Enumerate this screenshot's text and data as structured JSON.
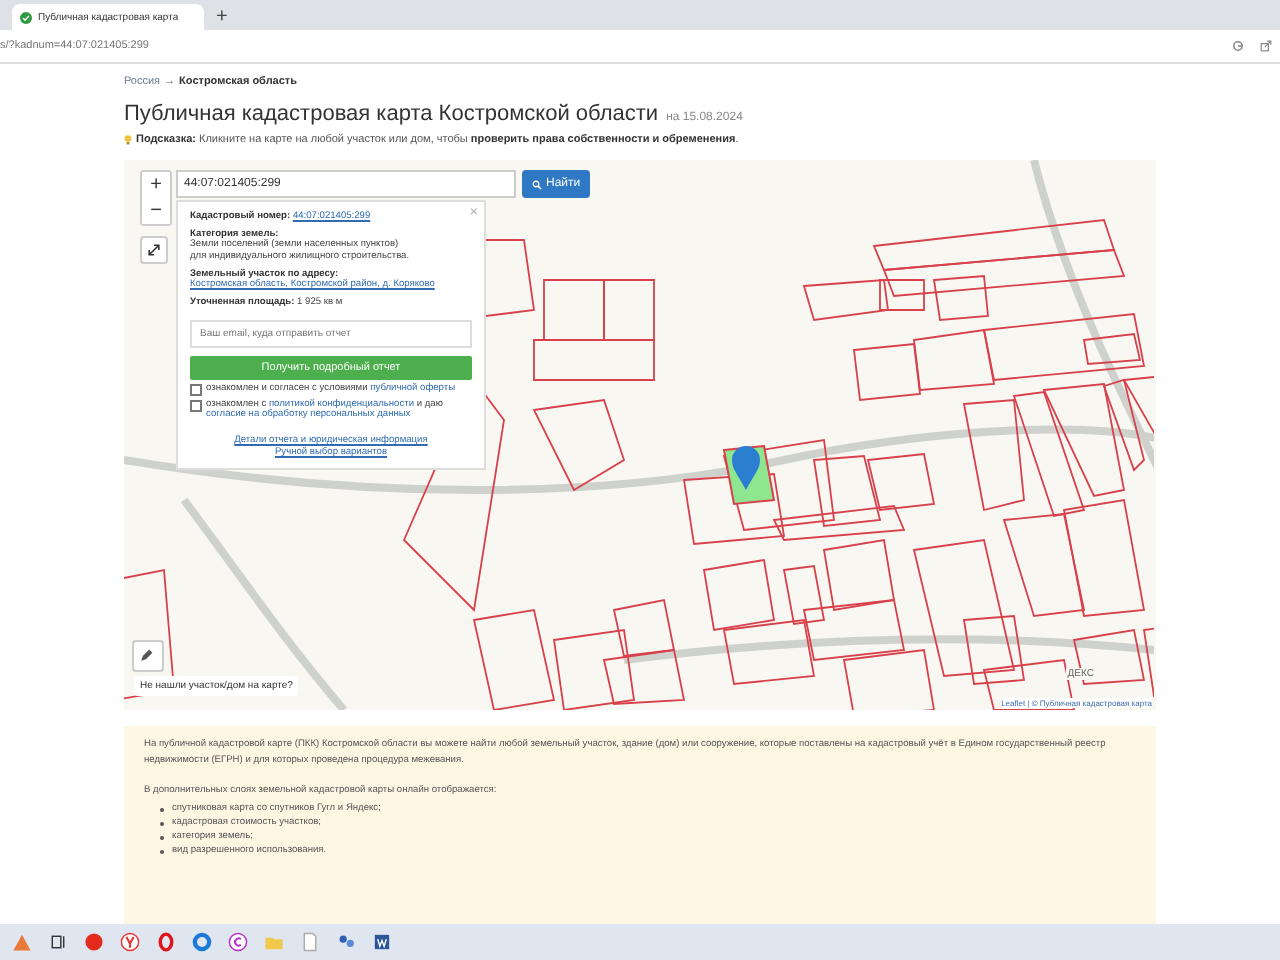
{
  "browser": {
    "tab_title": "Публичная кадастровая карта",
    "new_tab": "+",
    "url": "s/?kadnum=44:07:021405:299"
  },
  "breadcrumb": {
    "parent": "Россия",
    "separator": "→",
    "current": "Костромская область"
  },
  "title": "Публичная кадастровая карта Костромской области",
  "date": "на 15.08.2024",
  "hint": "**Подсказка:** Кликните на карте на любой участок или дом, чтобы **проверить права собственности и обременения**.",
  "search": {
    "value": "44:07:021405:299",
    "button": "Найти"
  },
  "map": {
    "zoom_in": "+",
    "zoom_out": "−",
    "not_found": "Не нашли участок/дом на карте?",
    "attribution": "Leaflet | © Публичная кадастровая карта",
    "logo": "ДЕКС"
  },
  "popup": {
    "close": "×",
    "fields": [
      {
        "label": "Кадастровый номер:",
        "value": "44:07:021405:299",
        "link": true
      },
      {
        "label": "Категория земель:",
        "value": "Земли поселений (земли населенных пунктов)",
        "link": false,
        "note": "для индивидуального жилищного строительства."
      },
      {
        "label": "Земельный участок по адресу:",
        "value": "Костромская область, Костромской район, д. Коряково",
        "link": true
      },
      {
        "label": "Уточненная площадь:",
        "value": "1 925 кв м",
        "link": false
      }
    ],
    "email_placeholder": "Ваш email, куда отправить отчет",
    "submit": "Получить подробный отчет",
    "consents": [
      {
        "checked": false,
        "parts": [
          {
            "text": "ознакомлен и согласен с условиями",
            "link": false
          },
          {
            "text": "публичной оферты",
            "link": true
          }
        ]
      },
      {
        "checked": false,
        "parts": [
          {
            "text": "ознакомлен с",
            "link": false
          },
          {
            "text": "политикой конфиденциальности",
            "link": true
          },
          {
            "text": "и даю",
            "link": false
          },
          {
            "text": "согласие на обработку персональных данных",
            "link": true
          }
        ]
      }
    ],
    "links": [
      "Детали отчета и юридическая информация",
      "Ручной выбор вариантов"
    ]
  },
  "info": {
    "paragraphs": [
      "На публичной кадастровой карте (ПКК) Костромской области вы можете найти любой земельный участок, здание (дом) или сооружение, которые поставлены на кадастровый учёт в Едином государственный реестр недвижимости (ЕГРН) и для которых проведена процедура межевания.",
      "В дополнительных слоях земельной кадастровой карты онлайн отображается:"
    ],
    "items": [
      "спутниковая карта со спутников Гугл и Яндекс;",
      "кадастровая стоимость участков;",
      "категория земель;",
      "вид разрешенного использования."
    ]
  }
}
